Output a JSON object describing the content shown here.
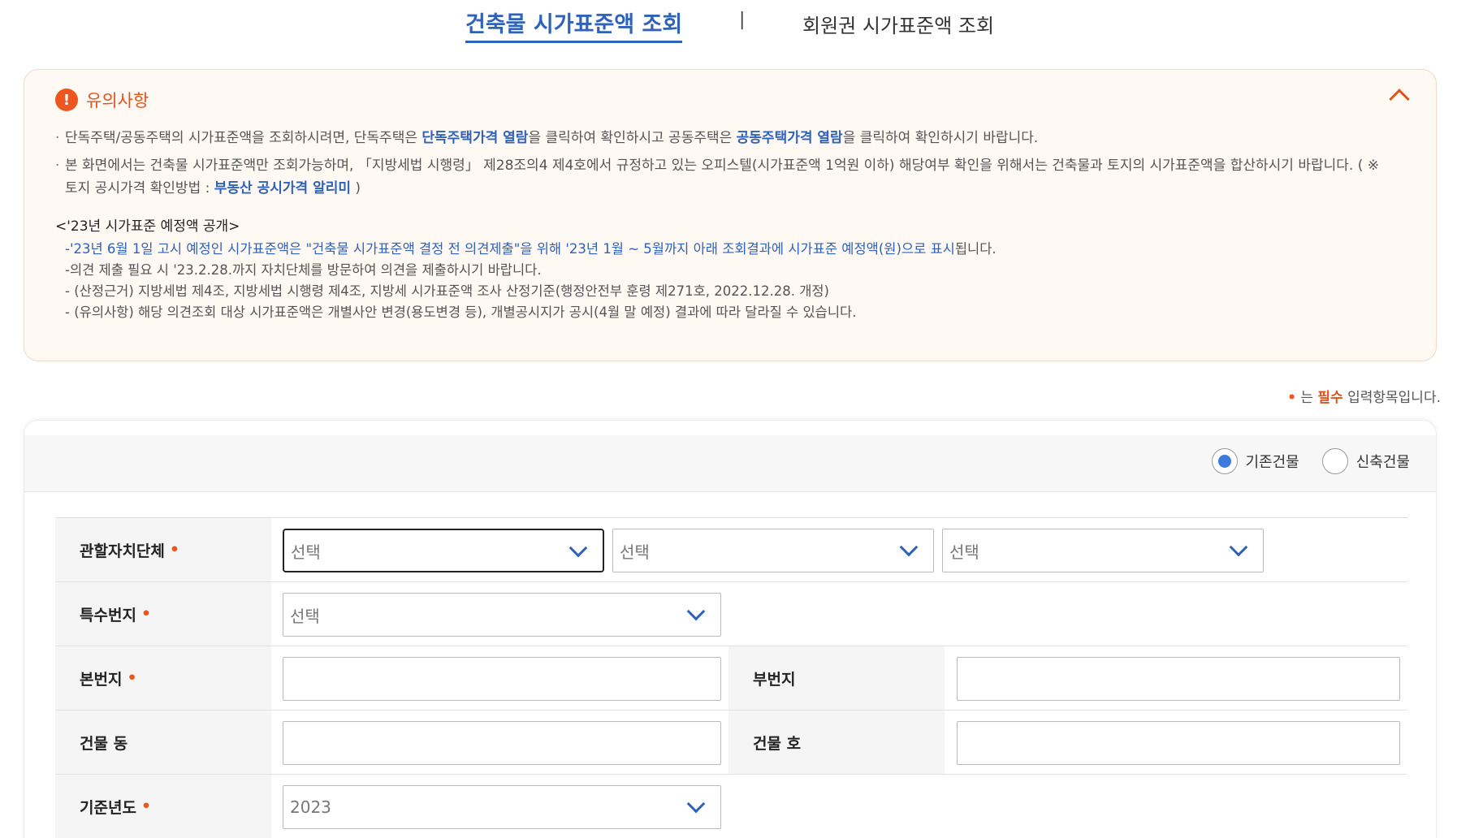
{
  "tabs": {
    "active": "건축물 시가표준액 조회",
    "separator": "|",
    "inactive": "회원권 시가표준액 조회"
  },
  "notice": {
    "title": "유의사항",
    "bullet1": {
      "a": "단독주택/공동주택의 시가표준액을 조회하시려면, 단독주택은 ",
      "link1": "단독주택가격 열람",
      "b": "을 클릭하여 확인하시고 공동주택은 ",
      "link2": "공동주택가격 열람",
      "c": "을 클릭하여 확인하시기 바랍니다."
    },
    "bullet2": {
      "a": "본 화면에서는 건축물 시가표준액만 조회가능하며, 「지방세법 시행령」 제28조의4 제4호에서 규정하고 있는 오피스텔(시가표준액 1억원 이하) 해당여부 확인을 위해서는 건축물과 토지의 시가표준액을 합산하시기 바랍니다. ( ※ 토지 공시가격 확인방법 : ",
      "link": "부동산 공시가격 알리미",
      "b": " )"
    },
    "preview_title": "<'23년 시가표준 예정액 공개>",
    "line1_blue": "-'23년 6월 1일 고시 예정인 시가표준액은 \"건축물 시가표준액 결정 전 의견제출\"을 위해 '23년 1월 ~ 5월까지 아래 조회결과에 시가표준 예정액(원)으로 표시",
    "line1_tail": "됩니다.",
    "line2": "-의견 제출 필요 시 '23.2.28.까지 자치단체를 방문하여 의견을 제출하시기 바랍니다.",
    "line3": "- (산정근거) 지방세법 제4조, 지방세법 시행령 제4조, 지방세 시가표준액 조사 산정기준(행정안전부 훈령 제271호, 2022.12.28. 개정)",
    "line4": "- (유의사항) 해당 의견조회 대상 시가표준액은 개별사안 변경(용도변경 등), 개별공시지가 공시(4월 말 예정) 결과에 따라 달라질 수 있습니다."
  },
  "required_hint": {
    "dot": "•",
    "pre": " 는 ",
    "req": "필수",
    "post": " 입력항목입니다."
  },
  "building_type": {
    "option1": "기존건물",
    "option2": "신축건물",
    "selected": "기존건물"
  },
  "form": {
    "required_mark": "•",
    "jurisdiction_label": "관할자치단체",
    "select_placeholder": "선택",
    "special_lot_label": "특수번지",
    "main_lot_label": "본번지",
    "sub_lot_label": "부번지",
    "building_dong_label": "건물 동",
    "building_ho_label": "건물 호",
    "base_year_label": "기준년도",
    "base_year_value": "2023"
  }
}
